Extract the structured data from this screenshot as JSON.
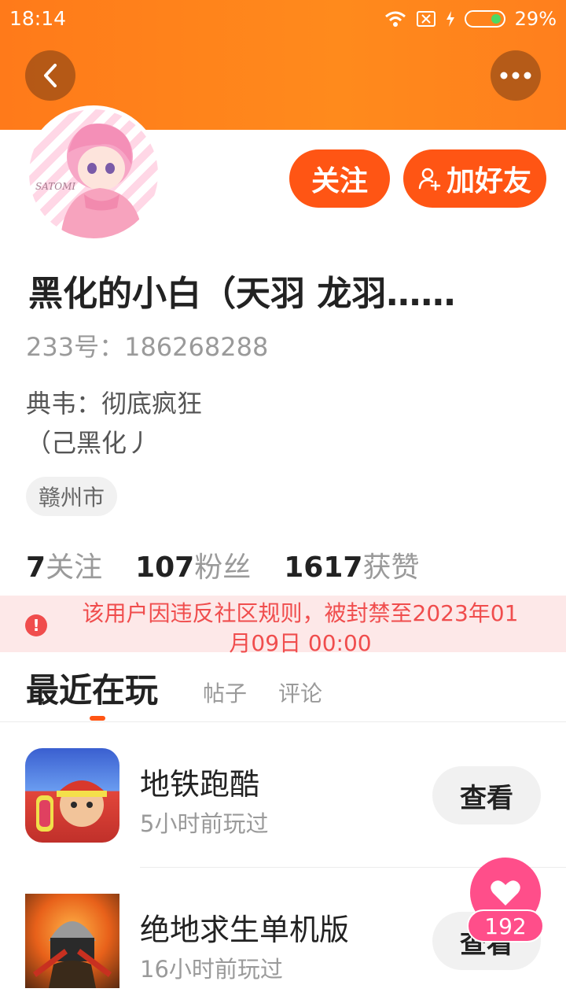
{
  "status_bar": {
    "time": "18:14",
    "battery": "29%"
  },
  "header": {
    "follow_label": "关注",
    "add_friend_label": "加好友"
  },
  "avatar_text": "SATOMI",
  "profile": {
    "name": "黑化的小白（天羽 龙羽……",
    "uid": "233号：186268288",
    "bio_line1": "典韦：彻底疯狂",
    "bio_line2": "（己黑化丿",
    "location": "赣州市"
  },
  "stats": {
    "following_count": "7",
    "following_label": "关注",
    "fans_count": "107",
    "fans_label": "粉丝",
    "likes_count": "1617",
    "likes_label": "获赞"
  },
  "ban_notice": {
    "line1": "该用户因违反社区规则，被封禁至2023年01",
    "line2": "月09日 00:00"
  },
  "tabs": {
    "recent": "最近在玩",
    "posts": "帖子",
    "comments": "评论"
  },
  "games": [
    {
      "title": "地铁跑酷",
      "played": "5小时前玩过",
      "view_label": "查看"
    },
    {
      "title": "绝地求生单机版",
      "played": "16小时前玩过",
      "view_label": "查看"
    }
  ],
  "like_fab": {
    "count": "192"
  },
  "colors": {
    "accent": "#ff5514",
    "header": "#ff7a1a",
    "ban_text": "#f04d4d",
    "ban_bg": "#fde8e8",
    "fab": "#ff4e8a"
  }
}
